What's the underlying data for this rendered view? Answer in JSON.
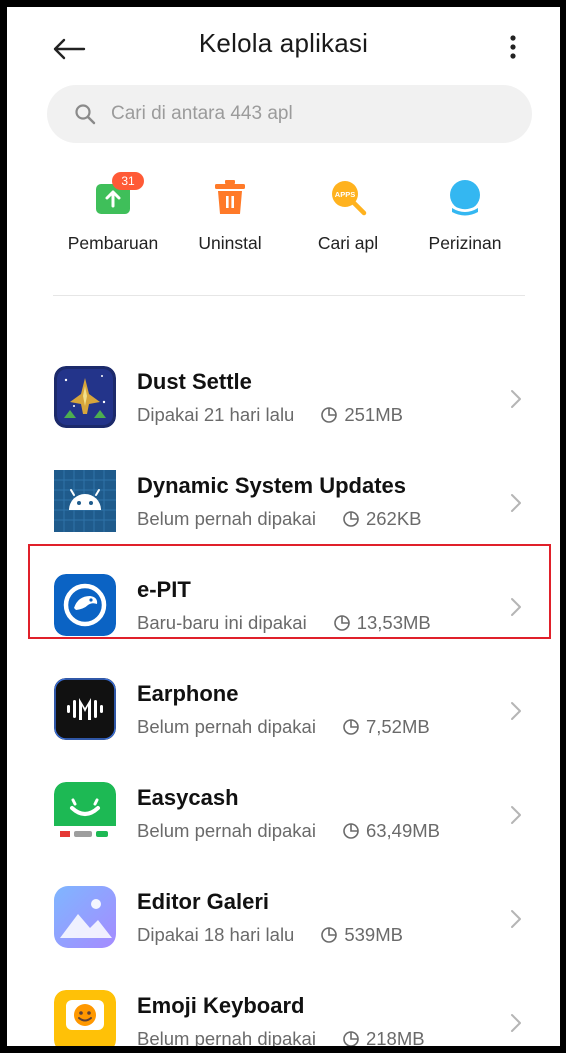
{
  "header": {
    "title": "Kelola aplikasi"
  },
  "search": {
    "placeholder": "Cari di antara 443 apl"
  },
  "quick_actions": [
    {
      "label": "Pembaruan",
      "icon": "update-arrow-icon",
      "badge": "31",
      "color": "#3fbf5a"
    },
    {
      "label": "Uninstal",
      "icon": "trash-icon",
      "color": "#ff7a29"
    },
    {
      "label": "Cari apl",
      "icon": "apps-search-icon",
      "icon_text": "APPS",
      "color": "#ffb21e"
    },
    {
      "label": "Perizinan",
      "icon": "permission-icon",
      "color": "#34b7f1"
    }
  ],
  "apps": [
    {
      "name": "Dust Settle",
      "usage": "Dipakai 21 hari lalu",
      "size": "251MB",
      "icon": "dust-settle-app-icon"
    },
    {
      "name": "Dynamic System Updates",
      "usage": "Belum pernah dipakai",
      "size": "262KB",
      "icon": "android-app-icon"
    },
    {
      "name": "e-PIT",
      "usage": "Baru-baru ini dipakai",
      "size": "13,53MB",
      "icon": "epit-app-icon",
      "highlighted": true
    },
    {
      "name": "Earphone",
      "usage": "Belum pernah dipakai",
      "size": "7,52MB",
      "icon": "earphone-app-icon"
    },
    {
      "name": "Easycash",
      "usage": "Belum pernah dipakai",
      "size": "63,49MB",
      "icon": "easycash-app-icon"
    },
    {
      "name": "Editor Galeri",
      "usage": "Dipakai 18 hari lalu",
      "size": "539MB",
      "icon": "gallery-editor-app-icon"
    },
    {
      "name": "Emoji Keyboard",
      "usage": "Belum pernah dipakai",
      "size": "218MB",
      "icon": "emoji-keyboard-app-icon"
    }
  ],
  "colors": {
    "highlight_border": "#e0202a",
    "accent_orange": "#ff5a36"
  }
}
